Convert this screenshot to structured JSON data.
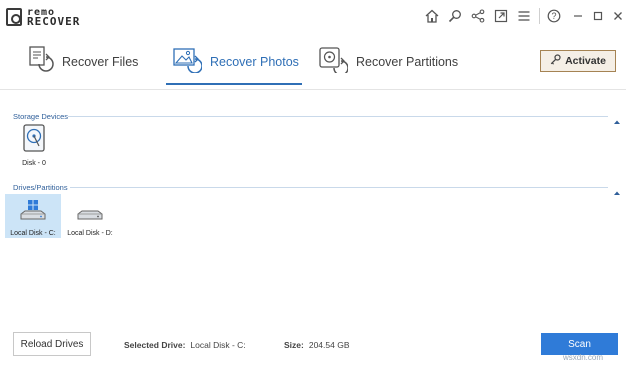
{
  "app": {
    "logo_line1": "remo",
    "logo_line2": "RECOVER"
  },
  "toolbar_icons": [
    "home-icon",
    "search-icon",
    "share-icon",
    "external-link-icon",
    "menu-icon",
    "help-icon"
  ],
  "window_controls": [
    "minimize-icon",
    "maximize-icon",
    "close-icon"
  ],
  "tabs": [
    {
      "label": "Recover Files",
      "icon": "recover-files-icon",
      "active": false
    },
    {
      "label": "Recover Photos",
      "icon": "recover-photos-icon",
      "active": true
    },
    {
      "label": "Recover Partitions",
      "icon": "recover-partitions-icon",
      "active": false
    }
  ],
  "activate_label": "Activate",
  "storage": {
    "heading": "Storage Devices",
    "devices": [
      {
        "label": "Disk - 0",
        "icon": "physical-disk-icon"
      }
    ]
  },
  "drives": {
    "heading": "Drives/Partitions",
    "items": [
      {
        "label": "Local Disk - C:",
        "icon": "windows-drive-icon",
        "selected": true
      },
      {
        "label": "Local Disk - D:",
        "icon": "drive-icon",
        "selected": false
      }
    ]
  },
  "footer": {
    "reload_label": "Reload Drives",
    "selected_drive_label": "Selected Drive:",
    "selected_drive_value": "Local Disk - C:",
    "size_label": "Size:",
    "size_value": "204.54 GB",
    "scan_label": "Scan"
  },
  "watermark": "wsxdn.com",
  "colors": {
    "accent": "#2f6fb6",
    "scan_button": "#2f7bd8",
    "selection": "#cce4f7"
  }
}
